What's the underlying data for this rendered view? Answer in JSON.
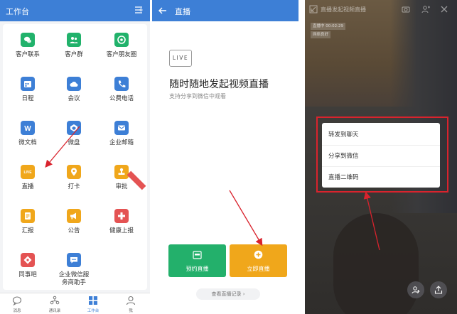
{
  "colors": {
    "header_blue": "#3d7fd6",
    "green": "#23b06b",
    "orange": "#f0a71b",
    "annotation_red": "#d9232d"
  },
  "workbench": {
    "title": "工作台",
    "filter_icon": "filter-icon",
    "apps": [
      {
        "label": "客户联系",
        "icon": "wechat-icon",
        "color": "#21b26b"
      },
      {
        "label": "客户群",
        "icon": "people-icon",
        "color": "#21b26b"
      },
      {
        "label": "客户朋友圈",
        "icon": "moments-icon",
        "color": "#21b26b"
      },
      {
        "label": "日程",
        "icon": "calendar-icon",
        "color": "#3d7fd6"
      },
      {
        "label": "会议",
        "icon": "cloud-icon",
        "color": "#3d7fd6"
      },
      {
        "label": "公费电话",
        "icon": "phone-icon",
        "color": "#3d7fd6"
      },
      {
        "label": "微文档",
        "icon": "document-icon",
        "color": "#3d7fd6"
      },
      {
        "label": "微盘",
        "icon": "drive-icon",
        "color": "#3d7fd6"
      },
      {
        "label": "企业邮箱",
        "icon": "mail-icon",
        "color": "#3d7fd6"
      },
      {
        "label": "直播",
        "icon": "live-icon",
        "color": "#f0a71b",
        "badge": "LIVE"
      },
      {
        "label": "打卡",
        "icon": "location-icon",
        "color": "#f0a71b"
      },
      {
        "label": "审批",
        "icon": "stamp-icon",
        "color": "#f0a71b"
      },
      {
        "label": "汇报",
        "icon": "report-icon",
        "color": "#f0a71b"
      },
      {
        "label": "公告",
        "icon": "megaphone-icon",
        "color": "#f0a71b"
      },
      {
        "label": "健康上报",
        "icon": "health-icon",
        "color": "#e45353"
      },
      {
        "label": "同事吧",
        "icon": "diamond-icon",
        "color": "#e45353"
      },
      {
        "label": "企业微信服务商助手",
        "icon": "chat-icon",
        "color": "#3d7fd6"
      }
    ],
    "tabs": [
      {
        "label": "消息",
        "icon": "message-icon",
        "active": false
      },
      {
        "label": "通讯录",
        "icon": "contacts-icon",
        "active": false
      },
      {
        "label": "工作台",
        "icon": "workbench-icon",
        "active": true
      },
      {
        "label": "我",
        "icon": "profile-icon",
        "active": false
      }
    ]
  },
  "live": {
    "title": "直播",
    "logo": "LIVE",
    "heading": "随时随地发起视频直播",
    "subtitle": "支持分享到微信中观看",
    "appointment_button": "预约直播",
    "start_button": "立即直播",
    "records_link": "查看直播记录 ›"
  },
  "viewer": {
    "title": "直播发起视频直播",
    "status_lines": [
      "直播中 00:02:29",
      "网络良好"
    ],
    "menu": [
      "转发到聊天",
      "分享到微信",
      "直播二维码"
    ]
  }
}
